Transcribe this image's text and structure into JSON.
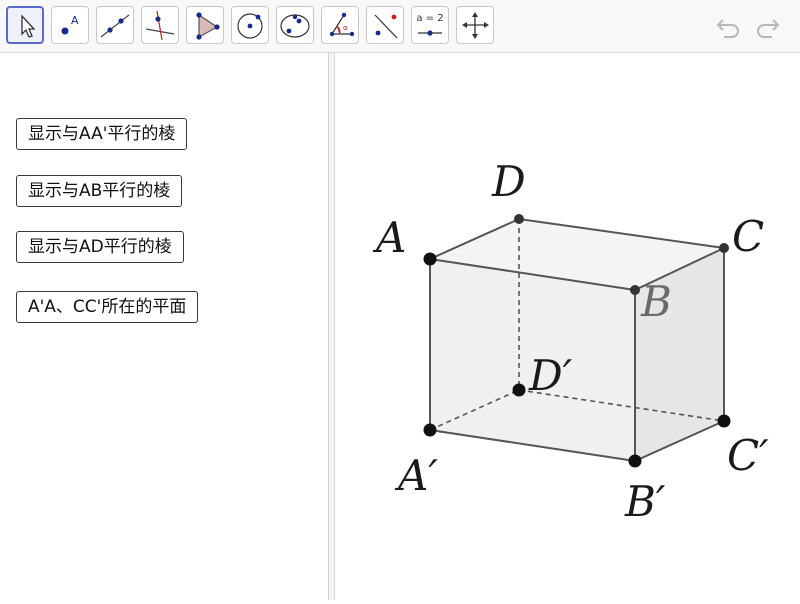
{
  "toolbar": {
    "tools": [
      {
        "name": "move-tool-icon",
        "active": true
      },
      {
        "name": "point-tool-icon"
      },
      {
        "name": "line-tool-icon"
      },
      {
        "name": "perpendicular-line-tool-icon"
      },
      {
        "name": "polygon-tool-icon"
      },
      {
        "name": "circle-tool-icon"
      },
      {
        "name": "ellipse-tool-icon"
      },
      {
        "name": "angle-tool-icon"
      },
      {
        "name": "reflect-tool-icon"
      },
      {
        "name": "slider-tool-icon",
        "label": "a = 2"
      },
      {
        "name": "move-graphics-view-icon"
      }
    ],
    "undo_icon": "undo-icon",
    "redo_icon": "redo-icon"
  },
  "buttons": [
    {
      "label": "显示与AA'平行的棱"
    },
    {
      "label": "显示与AB平行的棱"
    },
    {
      "label": "显示与AD平行的棱"
    },
    {
      "label": "A'A、CC'所在的平面"
    }
  ],
  "figure": {
    "labels": {
      "A": "A",
      "B": "B",
      "C": "C",
      "D": "D",
      "A1": "A′",
      "B1": "B′",
      "C1": "C′",
      "D1": "D′"
    }
  },
  "colors": {
    "active_tool": "#5a6ac8",
    "point": "#111111",
    "edge": "#555555",
    "face_fill": "#ececec"
  }
}
